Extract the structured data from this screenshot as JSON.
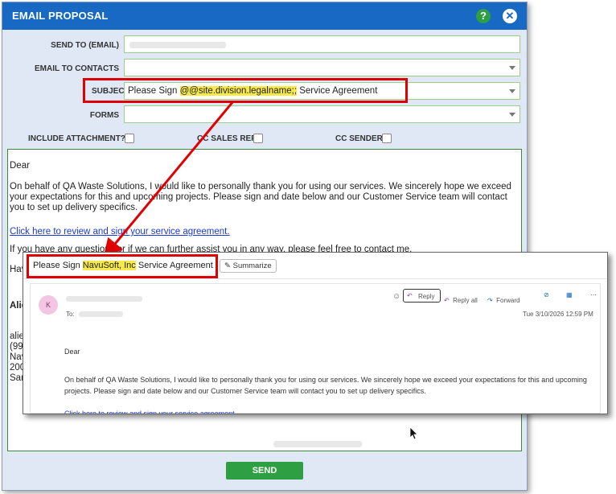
{
  "dialog": {
    "title": "EMAIL PROPOSAL",
    "help_icon": "?",
    "close_icon": "✕"
  },
  "form": {
    "send_to_label": "SEND TO (EMAIL)",
    "email_contacts_label": "EMAIL TO CONTACTS",
    "subject_label": "SUBJECT",
    "subject_prefix": "Please Sign ",
    "subject_token": "@@site.division.legalname;;",
    "subject_suffix": " Service Agreement",
    "forms_label": "FORMS",
    "include_attachment_label": "INCLUDE ATTACHMENT?",
    "cc_sales_rep_label": "CC SALES REP",
    "cc_sender_label": "CC SENDER"
  },
  "editor": {
    "greeting": "Dear",
    "paragraph1": "On behalf of QA Waste Solutions, I would like to personally thank you for using our services. We sincerely hope we exceed your expectations for this and upcoming projects. Please sign and date below and our Customer Service team will contact you to set up delivery specifics.",
    "link": "Click here to review and sign your service agreement.",
    "paragraph2": "If you have any questions or if we can further assist you in any way, please feel free to contact me.",
    "frag_hav": "Hav",
    "frag_alie": "Alie",
    "frag_alie2": "alie",
    "frag_99": "(99",
    "frag_nav": "Nav",
    "frag_200": "200",
    "frag_san": "San"
  },
  "send_button": "SEND",
  "preview": {
    "subject_prefix": "Please Sign ",
    "subject_value": "NavuSoft, Inc",
    "subject_suffix": " Service Agreement",
    "summarize": "Summarize",
    "avatar_letter": "K",
    "to_label": "To:",
    "reply": "Reply",
    "reply_all": "Reply all",
    "forward": "Forward",
    "timestamp": "Tue 3/10/2026 12:59 PM",
    "greeting": "Dear",
    "body": "On behalf of QA Waste Solutions, I would like to personally thank you for using our services. We sincerely hope we exceed your expectations for this and upcoming projects. Please sign and date below and our Customer Service team will contact you to set up delivery specifics.",
    "link": "Click here to review and sign your service agreement."
  },
  "colors": {
    "title_bar": "#1769c4",
    "accent_green": "#2ea043",
    "annotation_red": "#e00000",
    "highlight_yellow": "#f7e94a"
  }
}
